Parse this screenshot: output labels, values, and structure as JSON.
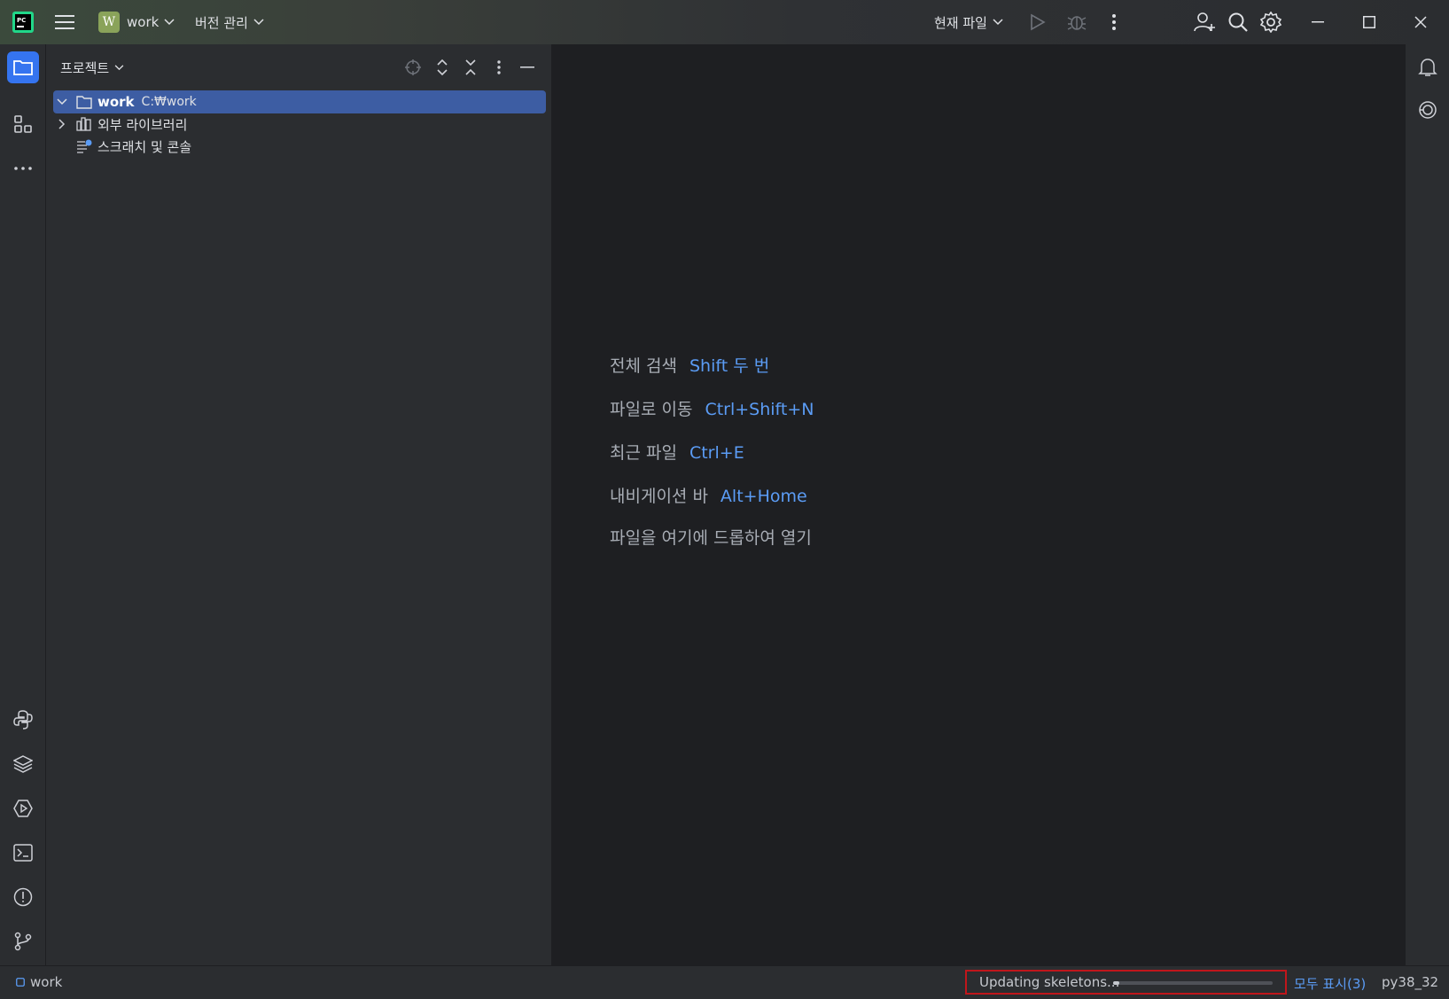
{
  "titlebar": {
    "project_badge": "W",
    "project_name": "work",
    "vcs_label": "버전 관리",
    "run_config": "현재 파일"
  },
  "project_panel": {
    "title": "프로젝트",
    "tree": {
      "root_name": "work",
      "root_path": "C:₩work",
      "external_libs": "외부 라이브러리",
      "scratches": "스크래치 및 콘솔"
    }
  },
  "editor": {
    "hints": [
      {
        "label": "전체 검색",
        "key": "Shift 두 번"
      },
      {
        "label": "파일로 이동",
        "key": "Ctrl+Shift+N"
      },
      {
        "label": "최근 파일",
        "key": "Ctrl+E"
      },
      {
        "label": "내비게이션 바",
        "key": "Alt+Home"
      },
      {
        "label": "파일을 여기에 드롭하여 열기",
        "key": ""
      }
    ]
  },
  "statusbar": {
    "project": "work",
    "progress_text": "Updating skeletons...",
    "progress_fraction": 0.04,
    "show_all": "모두 표시(3)",
    "interpreter": "py38_32"
  },
  "colors": {
    "accent": "#3574f0",
    "link": "#5b9cf5",
    "selection": "#3d5da3",
    "highlight_box": "#c0161b"
  }
}
